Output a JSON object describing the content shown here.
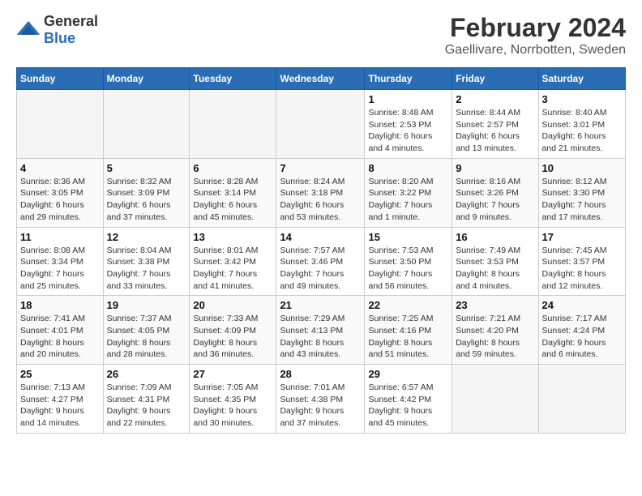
{
  "header": {
    "logo_general": "General",
    "logo_blue": "Blue",
    "title": "February 2024",
    "subtitle": "Gaellivare, Norrbotten, Sweden"
  },
  "weekdays": [
    "Sunday",
    "Monday",
    "Tuesday",
    "Wednesday",
    "Thursday",
    "Friday",
    "Saturday"
  ],
  "weeks": [
    [
      {
        "day": "",
        "info": ""
      },
      {
        "day": "",
        "info": ""
      },
      {
        "day": "",
        "info": ""
      },
      {
        "day": "",
        "info": ""
      },
      {
        "day": "1",
        "info": "Sunrise: 8:48 AM\nSunset: 2:53 PM\nDaylight: 6 hours\nand 4 minutes."
      },
      {
        "day": "2",
        "info": "Sunrise: 8:44 AM\nSunset: 2:57 PM\nDaylight: 6 hours\nand 13 minutes."
      },
      {
        "day": "3",
        "info": "Sunrise: 8:40 AM\nSunset: 3:01 PM\nDaylight: 6 hours\nand 21 minutes."
      }
    ],
    [
      {
        "day": "4",
        "info": "Sunrise: 8:36 AM\nSunset: 3:05 PM\nDaylight: 6 hours\nand 29 minutes."
      },
      {
        "day": "5",
        "info": "Sunrise: 8:32 AM\nSunset: 3:09 PM\nDaylight: 6 hours\nand 37 minutes."
      },
      {
        "day": "6",
        "info": "Sunrise: 8:28 AM\nSunset: 3:14 PM\nDaylight: 6 hours\nand 45 minutes."
      },
      {
        "day": "7",
        "info": "Sunrise: 8:24 AM\nSunset: 3:18 PM\nDaylight: 6 hours\nand 53 minutes."
      },
      {
        "day": "8",
        "info": "Sunrise: 8:20 AM\nSunset: 3:22 PM\nDaylight: 7 hours\nand 1 minute."
      },
      {
        "day": "9",
        "info": "Sunrise: 8:16 AM\nSunset: 3:26 PM\nDaylight: 7 hours\nand 9 minutes."
      },
      {
        "day": "10",
        "info": "Sunrise: 8:12 AM\nSunset: 3:30 PM\nDaylight: 7 hours\nand 17 minutes."
      }
    ],
    [
      {
        "day": "11",
        "info": "Sunrise: 8:08 AM\nSunset: 3:34 PM\nDaylight: 7 hours\nand 25 minutes."
      },
      {
        "day": "12",
        "info": "Sunrise: 8:04 AM\nSunset: 3:38 PM\nDaylight: 7 hours\nand 33 minutes."
      },
      {
        "day": "13",
        "info": "Sunrise: 8:01 AM\nSunset: 3:42 PM\nDaylight: 7 hours\nand 41 minutes."
      },
      {
        "day": "14",
        "info": "Sunrise: 7:57 AM\nSunset: 3:46 PM\nDaylight: 7 hours\nand 49 minutes."
      },
      {
        "day": "15",
        "info": "Sunrise: 7:53 AM\nSunset: 3:50 PM\nDaylight: 7 hours\nand 56 minutes."
      },
      {
        "day": "16",
        "info": "Sunrise: 7:49 AM\nSunset: 3:53 PM\nDaylight: 8 hours\nand 4 minutes."
      },
      {
        "day": "17",
        "info": "Sunrise: 7:45 AM\nSunset: 3:57 PM\nDaylight: 8 hours\nand 12 minutes."
      }
    ],
    [
      {
        "day": "18",
        "info": "Sunrise: 7:41 AM\nSunset: 4:01 PM\nDaylight: 8 hours\nand 20 minutes."
      },
      {
        "day": "19",
        "info": "Sunrise: 7:37 AM\nSunset: 4:05 PM\nDaylight: 8 hours\nand 28 minutes."
      },
      {
        "day": "20",
        "info": "Sunrise: 7:33 AM\nSunset: 4:09 PM\nDaylight: 8 hours\nand 36 minutes."
      },
      {
        "day": "21",
        "info": "Sunrise: 7:29 AM\nSunset: 4:13 PM\nDaylight: 8 hours\nand 43 minutes."
      },
      {
        "day": "22",
        "info": "Sunrise: 7:25 AM\nSunset: 4:16 PM\nDaylight: 8 hours\nand 51 minutes."
      },
      {
        "day": "23",
        "info": "Sunrise: 7:21 AM\nSunset: 4:20 PM\nDaylight: 8 hours\nand 59 minutes."
      },
      {
        "day": "24",
        "info": "Sunrise: 7:17 AM\nSunset: 4:24 PM\nDaylight: 9 hours\nand 6 minutes."
      }
    ],
    [
      {
        "day": "25",
        "info": "Sunrise: 7:13 AM\nSunset: 4:27 PM\nDaylight: 9 hours\nand 14 minutes."
      },
      {
        "day": "26",
        "info": "Sunrise: 7:09 AM\nSunset: 4:31 PM\nDaylight: 9 hours\nand 22 minutes."
      },
      {
        "day": "27",
        "info": "Sunrise: 7:05 AM\nSunset: 4:35 PM\nDaylight: 9 hours\nand 30 minutes."
      },
      {
        "day": "28",
        "info": "Sunrise: 7:01 AM\nSunset: 4:38 PM\nDaylight: 9 hours\nand 37 minutes."
      },
      {
        "day": "29",
        "info": "Sunrise: 6:57 AM\nSunset: 4:42 PM\nDaylight: 9 hours\nand 45 minutes."
      },
      {
        "day": "",
        "info": ""
      },
      {
        "day": "",
        "info": ""
      }
    ]
  ]
}
